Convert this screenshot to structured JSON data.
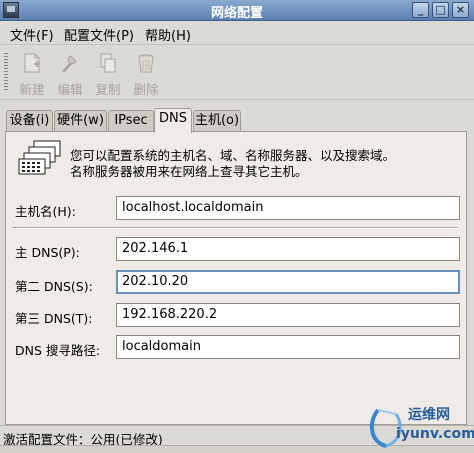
{
  "window": {
    "title": "网络配置"
  },
  "title_buttons": {
    "minimize": "_",
    "maximize": "□",
    "close": "×"
  },
  "menu": [
    {
      "label": "文件(F)"
    },
    {
      "label": "配置文件(P)"
    },
    {
      "label": "帮助(H)"
    }
  ],
  "toolbar": [
    {
      "label": "新建",
      "icon": "new-icon"
    },
    {
      "label": "编辑",
      "icon": "edit-icon"
    },
    {
      "label": "复制",
      "icon": "copy-icon"
    },
    {
      "label": "删除",
      "icon": "delete-icon"
    }
  ],
  "tabs": [
    {
      "label": "设备(i)"
    },
    {
      "label": "硬件(w)"
    },
    {
      "label": "IPsec"
    },
    {
      "label": "DNS",
      "active": true
    },
    {
      "label": "主机(o)"
    }
  ],
  "dns_panel": {
    "info_line1": "您可以配置系统的主机名、域、名称服务器、以及搜索域。",
    "info_line2": "名称服务器被用来在网络上查寻其它主机。",
    "hostname": {
      "label": "主机名(H):",
      "value": "localhost.localdomain"
    },
    "primary_dns": {
      "label": "主 DNS(P):",
      "value": "202.146.1"
    },
    "secondary_dns": {
      "label": "第二 DNS(S):",
      "value": "202.10.20"
    },
    "tertiary_dns": {
      "label": "第三 DNS(T):",
      "value": "192.168.220.2"
    },
    "search_path": {
      "label": "DNS 搜寻路径:",
      "value": "localdomain"
    }
  },
  "status": {
    "text": "激活配置文件：公用(已修改)"
  },
  "watermark": {
    "brand": "运维网",
    "domain": "iyunv.com"
  },
  "colors": {
    "titlebar": "#5b80b0",
    "background": "#dcdad5",
    "panel": "#efece7",
    "focus_border": "#6a90c0"
  }
}
